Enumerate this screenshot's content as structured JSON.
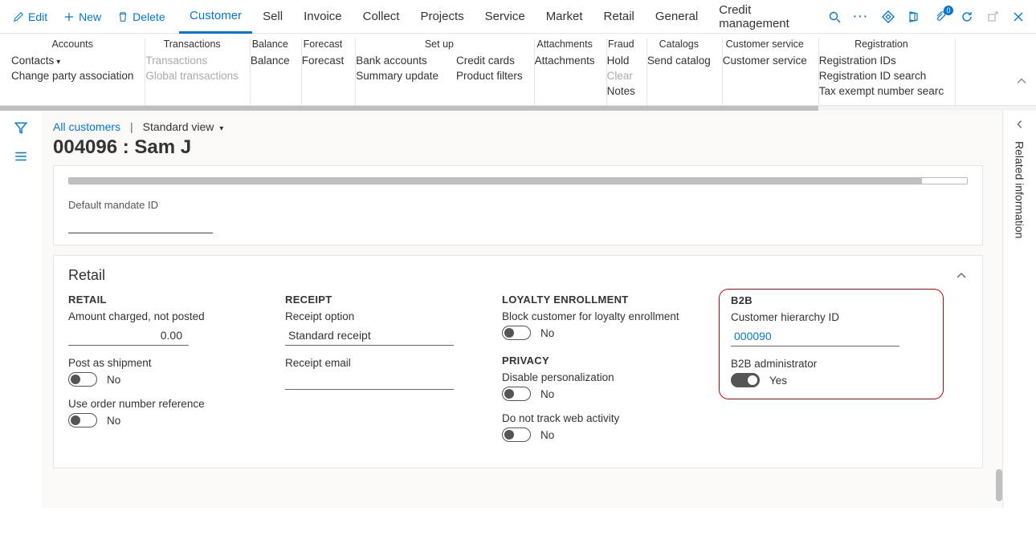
{
  "cmdbar": {
    "edit": "Edit",
    "new": "New",
    "delete": "Delete"
  },
  "tabs": [
    "Customer",
    "Sell",
    "Invoice",
    "Collect",
    "Projects",
    "Service",
    "Market",
    "Retail",
    "General",
    "Credit management"
  ],
  "active_tab": "Customer",
  "attachments_badge": "0",
  "ribbon": {
    "groups": [
      {
        "label": "Accounts",
        "cols": [
          [
            "Contacts",
            "Change party association"
          ]
        ]
      },
      {
        "label": "Transactions",
        "cols": [
          [
            "Transactions",
            "Global transactions"
          ]
        ],
        "disabled": true
      },
      {
        "label": "Balance",
        "cols": [
          [
            "Balance"
          ]
        ]
      },
      {
        "label": "Forecast",
        "cols": [
          [
            "Forecast"
          ]
        ]
      },
      {
        "label": "Set up",
        "cols": [
          [
            "Bank accounts",
            "Summary update"
          ],
          [
            "Credit cards",
            "Product filters"
          ]
        ]
      },
      {
        "label": "Attachments",
        "cols": [
          [
            "Attachments"
          ]
        ]
      },
      {
        "label": "Fraud",
        "cols": [
          [
            "Hold",
            "Clear",
            "Notes"
          ]
        ],
        "disabled_items": [
          "Clear"
        ]
      },
      {
        "label": "Catalogs",
        "cols": [
          [
            "Send catalog"
          ]
        ]
      },
      {
        "label": "Customer service",
        "cols": [
          [
            "Customer service"
          ]
        ]
      },
      {
        "label": "Registration",
        "cols": [
          [
            "Registration IDs",
            "Registration ID search",
            "Tax exempt number searc"
          ]
        ]
      }
    ]
  },
  "breadcrumb": {
    "link": "All customers",
    "view": "Standard view"
  },
  "record_title": "004096 : Sam J",
  "upper_card": {
    "mandate_label": "Default mandate ID",
    "mandate_value": ""
  },
  "retail_card": {
    "title": "Retail",
    "retail": {
      "head": "RETAIL",
      "amount_label": "Amount charged, not posted",
      "amount_value": "0.00",
      "post_as_shipment_label": "Post as shipment",
      "post_as_shipment_value": "No",
      "use_order_ref_label": "Use order number reference",
      "use_order_ref_value": "No"
    },
    "receipt": {
      "head": "RECEIPT",
      "option_label": "Receipt option",
      "option_value": "Standard receipt",
      "email_label": "Receipt email",
      "email_value": ""
    },
    "loyalty": {
      "head": "LOYALTY ENROLLMENT",
      "block_label": "Block customer for loyalty enrollment",
      "block_value": "No"
    },
    "privacy": {
      "head": "PRIVACY",
      "disable_pers_label": "Disable personalization",
      "disable_pers_value": "No",
      "no_track_label": "Do not track web activity",
      "no_track_value": "No"
    },
    "b2b": {
      "head": "B2B",
      "hier_label": "Customer hierarchy ID",
      "hier_value": "000090",
      "admin_label": "B2B administrator",
      "admin_value": "Yes"
    }
  },
  "right_rail": {
    "label": "Related information"
  }
}
